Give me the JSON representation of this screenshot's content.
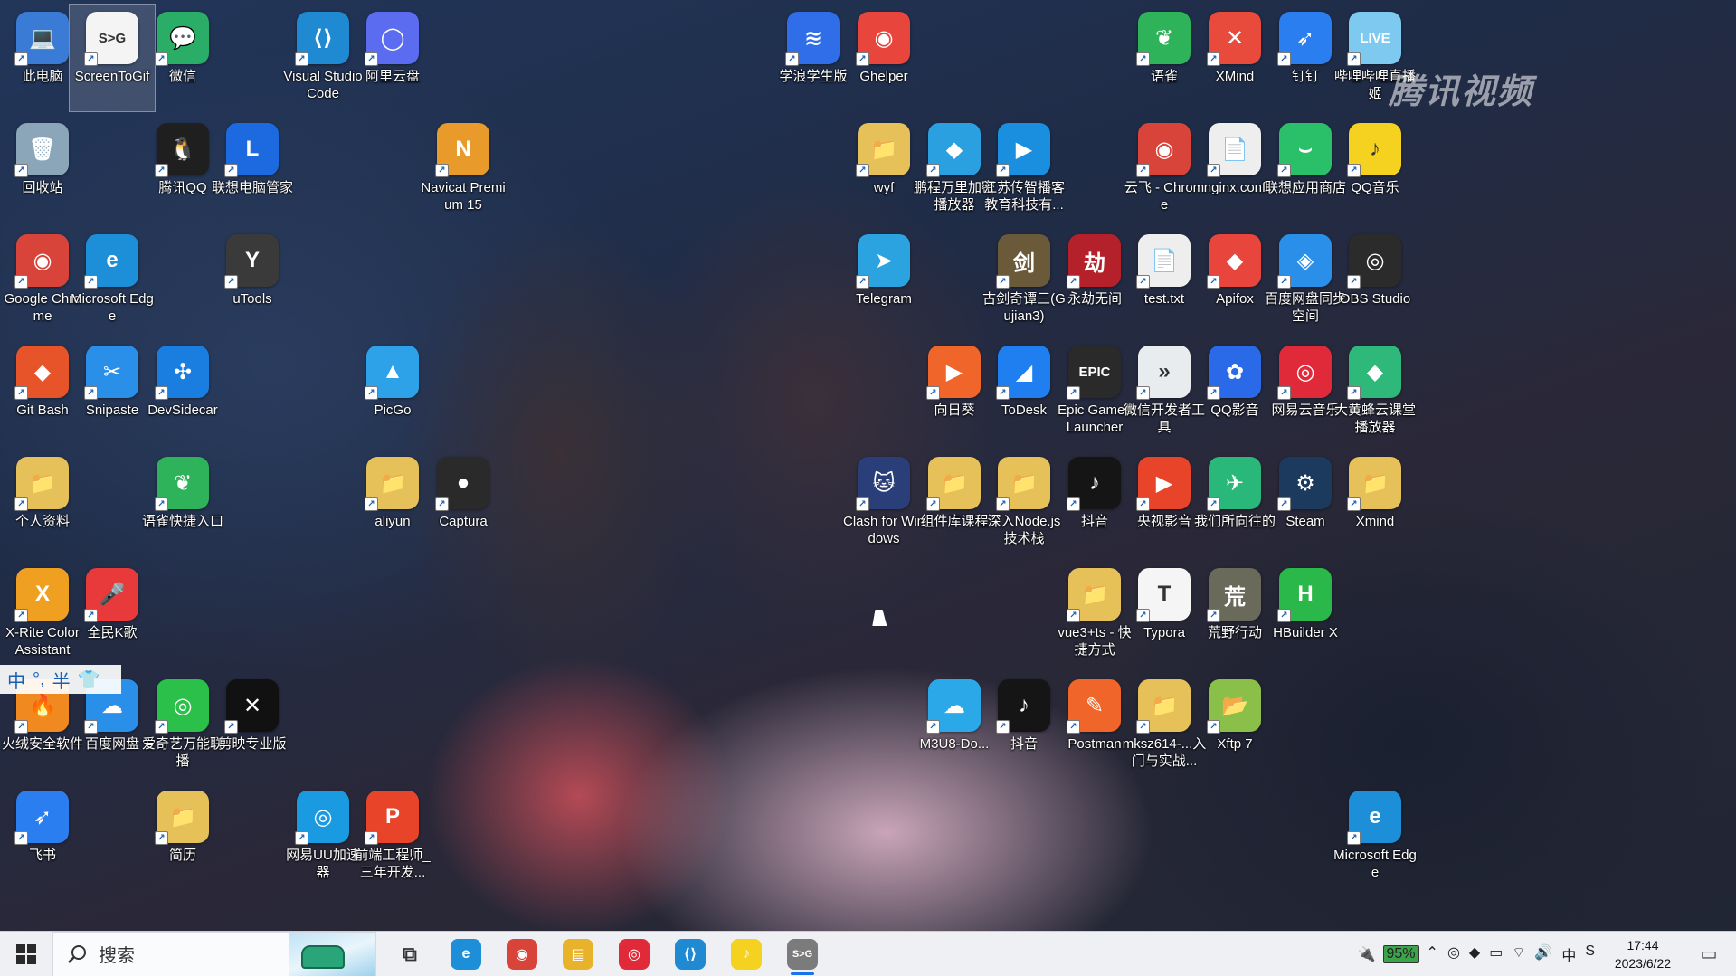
{
  "desktop": {
    "icons": [
      {
        "label": "此电脑",
        "glyph": "💻",
        "color": "#3a7bd5"
      },
      {
        "label": "ScreenToGif",
        "glyph": "S>G",
        "color": "#f4f4f4",
        "dark": true
      },
      {
        "label": "微信",
        "glyph": "💬",
        "color": "#2aae67"
      },
      {
        "label": "Visual Studio Code",
        "glyph": "⟨⟩",
        "color": "#1f8ad2"
      },
      {
        "label": "阿里云盘",
        "glyph": "◯",
        "color": "#5b6cf0"
      },
      {
        "label": "学浪学生版",
        "glyph": "≋",
        "color": "#2f6ee8"
      },
      {
        "label": "Ghelper",
        "glyph": "◉",
        "color": "#e8453c"
      },
      {
        "label": "语雀",
        "glyph": "❦",
        "color": "#2fb35a"
      },
      {
        "label": "XMind",
        "glyph": "✕",
        "color": "#e84a3c"
      },
      {
        "label": "钉钉",
        "glyph": "➶",
        "color": "#2b7ef0"
      },
      {
        "label": "哔哩哔哩直播姬",
        "glyph": "LIVE",
        "color": "#7ec9f0"
      },
      {
        "label": "回收站",
        "glyph": "🗑",
        "color": "#8aa6b8"
      },
      {
        "label": "腾讯QQ",
        "glyph": "🐧",
        "color": "#1f1f1f"
      },
      {
        "label": "联想电脑管家",
        "glyph": "L",
        "color": "#1d6ae0"
      },
      {
        "label": "Navicat Premium 15",
        "glyph": "N",
        "color": "#e89a2a"
      },
      {
        "label": "wyf",
        "glyph": "📁",
        "color": "#e6c15a"
      },
      {
        "label": "鹏程万里加密播放器",
        "glyph": "◆",
        "color": "#2aa0e0"
      },
      {
        "label": "江苏传智播客教育科技有...",
        "glyph": "▶",
        "color": "#1a8fe0"
      },
      {
        "label": "云飞 - Chrome",
        "glyph": "◉",
        "color": "#d9443a"
      },
      {
        "label": "nginx.conf",
        "glyph": "📄",
        "color": "#eeeeee",
        "dark": true
      },
      {
        "label": "联想应用商店",
        "glyph": "⌣",
        "color": "#2ac06a"
      },
      {
        "label": "QQ音乐",
        "glyph": "♪",
        "color": "#f4d21f",
        "dark": true
      },
      {
        "label": "Google Chrome",
        "glyph": "◉",
        "color": "#d9443a"
      },
      {
        "label": "Microsoft Edge",
        "glyph": "e",
        "color": "#1c8fd8"
      },
      {
        "label": "uTools",
        "glyph": "Y",
        "color": "#3a3a3a"
      },
      {
        "label": "Telegram",
        "glyph": "➤",
        "color": "#2aa3e0"
      },
      {
        "label": "古剑奇谭三(Gujian3)",
        "glyph": "剑",
        "color": "#6b5a3a"
      },
      {
        "label": "永劫无间",
        "glyph": "劫",
        "color": "#b5212a"
      },
      {
        "label": "test.txt",
        "glyph": "📄",
        "color": "#eeeeee",
        "dark": true
      },
      {
        "label": "Apifox",
        "glyph": "◆",
        "color": "#e8453c"
      },
      {
        "label": "百度网盘同步空间",
        "glyph": "◈",
        "color": "#2a8fe8"
      },
      {
        "label": "OBS Studio",
        "glyph": "◎",
        "color": "#2b2b2b"
      },
      {
        "label": "Git Bash",
        "glyph": "◆",
        "color": "#e8542a"
      },
      {
        "label": "Snipaste",
        "glyph": "✂",
        "color": "#2a8fe8"
      },
      {
        "label": "DevSidecar",
        "glyph": "✣",
        "color": "#1a7ee0"
      },
      {
        "label": "PicGo",
        "glyph": "▲",
        "color": "#2ea2e8"
      },
      {
        "label": "向日葵",
        "glyph": "▶",
        "color": "#f0652a"
      },
      {
        "label": "ToDesk",
        "glyph": "◢",
        "color": "#1f7ff0"
      },
      {
        "label": "Epic Games Launcher",
        "glyph": "EPIC",
        "color": "#2a2a2a"
      },
      {
        "label": "微信开发者工具",
        "glyph": "»",
        "color": "#e9ecef",
        "dark": true
      },
      {
        "label": "QQ影音",
        "glyph": "✿",
        "color": "#2a6ae8"
      },
      {
        "label": "网易云音乐",
        "glyph": "◎",
        "color": "#e02a3a"
      },
      {
        "label": "大黄蜂云课堂播放器",
        "glyph": "◆",
        "color": "#2eb87a"
      },
      {
        "label": "个人资料",
        "glyph": "📁",
        "color": "#e6c15a"
      },
      {
        "label": "语雀快捷入口",
        "glyph": "❦",
        "color": "#2fb35a"
      },
      {
        "label": "aliyun",
        "glyph": "📁",
        "color": "#e6c15a"
      },
      {
        "label": "Captura",
        "glyph": "●",
        "color": "#2a2a2a"
      },
      {
        "label": "Clash for Windows",
        "glyph": "🐱",
        "color": "#2a3f7a"
      },
      {
        "label": "组件库课程",
        "glyph": "📁",
        "color": "#e6c15a"
      },
      {
        "label": "深入Node.js技术栈",
        "glyph": "📁",
        "color": "#e6c15a"
      },
      {
        "label": "抖音",
        "glyph": "♪",
        "color": "#151515"
      },
      {
        "label": "央视影音",
        "glyph": "▶",
        "color": "#e8442a"
      },
      {
        "label": "我们所向往的",
        "glyph": "✈",
        "color": "#2ab87a"
      },
      {
        "label": "Steam",
        "glyph": "⚙",
        "color": "#1b3a5e"
      },
      {
        "label": "Xmind",
        "glyph": "📁",
        "color": "#e6c15a"
      },
      {
        "label": "X-Rite Color Assistant",
        "glyph": "X",
        "color": "#f0a020"
      },
      {
        "label": "全民K歌",
        "glyph": "🎤",
        "color": "#e83a3a"
      },
      {
        "label": "vue3+ts - 快捷方式",
        "glyph": "📁",
        "color": "#e6c15a"
      },
      {
        "label": "Typora",
        "glyph": "T",
        "color": "#f5f5f5",
        "dark": true
      },
      {
        "label": "荒野行动",
        "glyph": "荒",
        "color": "#6a6a5a"
      },
      {
        "label": "HBuilder X",
        "glyph": "H",
        "color": "#2ab84a"
      },
      {
        "label": "火绒安全软件",
        "glyph": "🔥",
        "color": "#f08a20"
      },
      {
        "label": "百度网盘",
        "glyph": "☁",
        "color": "#2a8fe8"
      },
      {
        "label": "爱奇艺万能联播",
        "glyph": "◎",
        "color": "#2ac04a"
      },
      {
        "label": "剪映专业版",
        "glyph": "✕",
        "color": "#111111"
      },
      {
        "label": "M3U8-Do...",
        "glyph": "☁",
        "color": "#2aa8e8"
      },
      {
        "label": "抖音",
        "glyph": "♪",
        "color": "#151515"
      },
      {
        "label": "Postman",
        "glyph": "✎",
        "color": "#f0652a"
      },
      {
        "label": "mksz614-...入门与实战...",
        "glyph": "📁",
        "color": "#e6c15a"
      },
      {
        "label": "Xftp 7",
        "glyph": "📂",
        "color": "#8ac04a"
      },
      {
        "label": "飞书",
        "glyph": "➶",
        "color": "#2a7ef0"
      },
      {
        "label": "简历",
        "glyph": "📁",
        "color": "#e6c15a"
      },
      {
        "label": "网易UU加速器",
        "glyph": "◎",
        "color": "#1a9ae0"
      },
      {
        "label": "前端工程师_三年开发...",
        "glyph": "P",
        "color": "#e8442a"
      },
      {
        "label": "Microsoft Edge",
        "glyph": "e",
        "color": "#1c8fd8"
      }
    ],
    "watermark": "腾讯视频",
    "ime": {
      "lang": "中",
      "punct": "°,",
      "width": "半"
    }
  },
  "taskbar": {
    "search_placeholder": "搜索",
    "apps": [
      {
        "name": "taskview",
        "glyph": "⧉",
        "color": "#333333"
      },
      {
        "name": "edge",
        "glyph": "e",
        "color": "#1c8fd8"
      },
      {
        "name": "chrome",
        "glyph": "◉",
        "color": "#d9443a"
      },
      {
        "name": "explorer",
        "glyph": "▤",
        "color": "#e8b32a"
      },
      {
        "name": "netease-music",
        "glyph": "◎",
        "color": "#e02a3a"
      },
      {
        "name": "vscode",
        "glyph": "⟨⟩",
        "color": "#1f8ad2"
      },
      {
        "name": "qqmusic",
        "glyph": "♪",
        "color": "#f4d21f"
      },
      {
        "name": "screentogif",
        "glyph": "S>G",
        "color": "#7b7b7b"
      }
    ],
    "battery": "95%",
    "tray_icons": [
      "⌃",
      "◎",
      "◆",
      "▭",
      "⌔",
      "🔊",
      "中",
      "S"
    ],
    "time": "17:44",
    "date": "2023/6/22"
  }
}
